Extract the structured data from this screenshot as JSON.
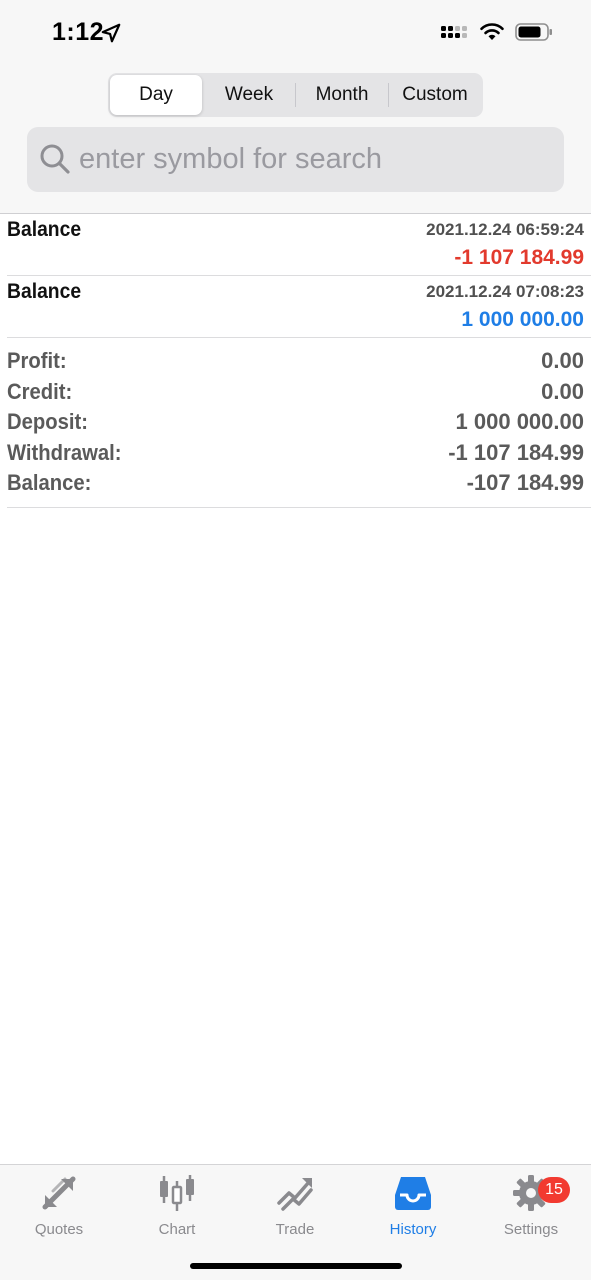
{
  "status": {
    "time": "1:12"
  },
  "segments": [
    {
      "label": "Day",
      "active": true
    },
    {
      "label": "Week",
      "active": false
    },
    {
      "label": "Month",
      "active": false
    },
    {
      "label": "Custom",
      "active": false
    }
  ],
  "search": {
    "placeholder": "enter symbol for search",
    "value": ""
  },
  "deals": [
    {
      "type": "Balance",
      "time": "2021.12.24 06:59:24",
      "amount": "-1 107 184.99"
    },
    {
      "type": "Balance",
      "time": "2021.12.24 07:08:23",
      "amount": "1 000 000.00"
    }
  ],
  "summary": {
    "profit_label": "Profit:",
    "profit_value": "0.00",
    "credit_label": "Credit:",
    "credit_value": "0.00",
    "deposit_label": "Deposit:",
    "deposit_value": "1 000 000.00",
    "withdrawal_label": "Withdrawal:",
    "withdrawal_value": "-1 107 184.99",
    "balance_label": "Balance:",
    "balance_value": "-107 184.99"
  },
  "tabs": [
    {
      "label": "Quotes",
      "icon": "quotes-arrows-icon"
    },
    {
      "label": "Chart",
      "icon": "candlestick-icon"
    },
    {
      "label": "Trade",
      "icon": "trade-trend-icon"
    },
    {
      "label": "History",
      "icon": "inbox-tray-icon",
      "active": true
    },
    {
      "label": "Settings",
      "icon": "gear-icon",
      "badge": "15"
    }
  ],
  "colors": {
    "accent": "#1f7ee6",
    "negative": "#e23a2d",
    "badge": "#f23a30"
  }
}
